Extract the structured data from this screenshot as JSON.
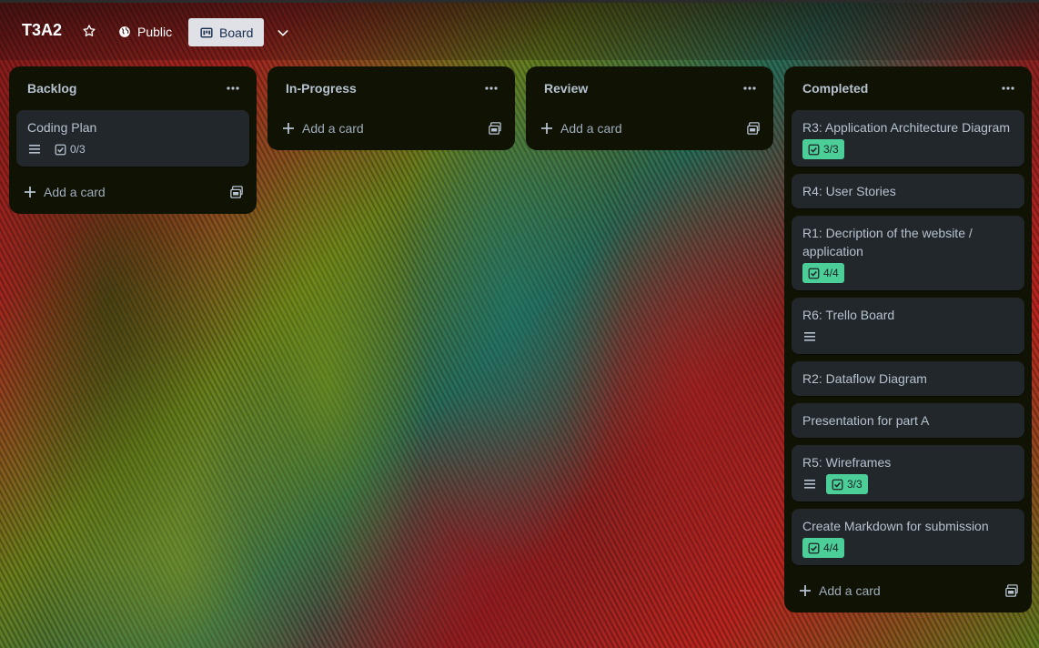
{
  "header": {
    "board_title": "T3A2",
    "visibility_label": "Public",
    "view_label": "Board",
    "icons": [
      "star-icon",
      "globe-icon",
      "board-icon",
      "chevron-down-icon"
    ]
  },
  "lists": [
    {
      "title": "Backlog",
      "add_label": "Add a card",
      "cards": [
        {
          "title": "Coding Plan",
          "has_description": true,
          "checklist": "0/3",
          "checklist_complete": false
        }
      ]
    },
    {
      "title": "In-Progress",
      "add_label": "Add a card",
      "cards": []
    },
    {
      "title": "Review",
      "add_label": "Add a card",
      "cards": []
    },
    {
      "title": "Completed",
      "add_label": "Add a card",
      "cards": [
        {
          "title": "R3: Application Architecture Diagram",
          "has_description": false,
          "checklist": "3/3",
          "checklist_complete": true
        },
        {
          "title": "R4: User Stories",
          "has_description": false,
          "checklist": "",
          "checklist_complete": false
        },
        {
          "title": "R1: Decription of the website / application",
          "has_description": false,
          "checklist": "4/4",
          "checklist_complete": true
        },
        {
          "title": "R6: Trello Board",
          "has_description": true,
          "checklist": "",
          "checklist_complete": false
        },
        {
          "title": "R2: Dataflow Diagram",
          "has_description": false,
          "checklist": "",
          "checklist_complete": false
        },
        {
          "title": "Presentation for part A",
          "has_description": false,
          "checklist": "",
          "checklist_complete": false
        },
        {
          "title": "R5: Wireframes",
          "has_description": true,
          "checklist": "3/3",
          "checklist_complete": true
        },
        {
          "title": "Create Markdown for submission",
          "has_description": false,
          "checklist": "4/4",
          "checklist_complete": true
        }
      ]
    }
  ],
  "colors": {
    "list_bg": "#101204",
    "card_bg": "#22272b",
    "checklist_done_bg": "#4bce97",
    "text": "#b6c2cf"
  }
}
